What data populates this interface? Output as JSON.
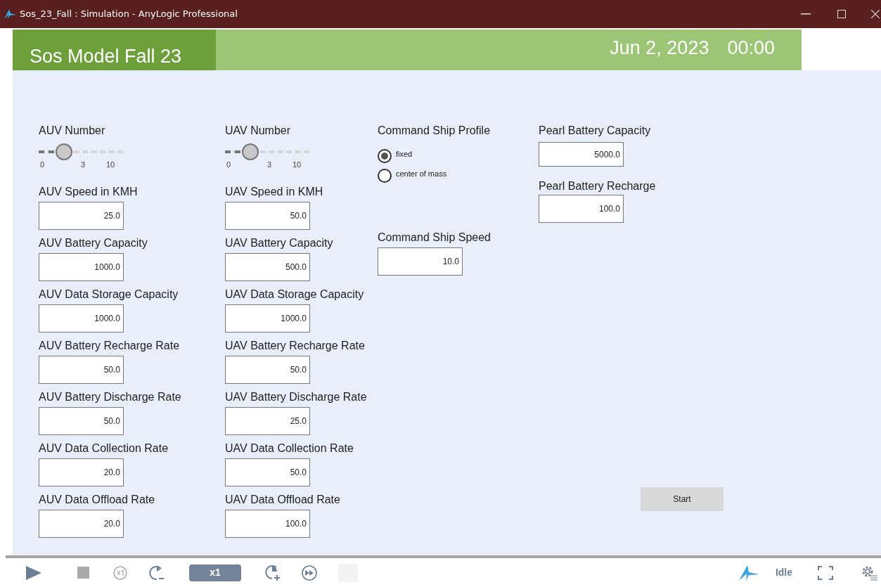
{
  "window": {
    "title": "Sos_23_Fall : Simulation - AnyLogic Professional"
  },
  "header": {
    "title": "Sos Model Fall 23",
    "date": "Jun 2, 2023",
    "time": "00:00"
  },
  "columns": [
    {
      "slider": {
        "label": "AUV Number",
        "level": 0.3,
        "ticks": [
          "0",
          "3",
          "10"
        ]
      },
      "fields": [
        {
          "label": "AUV Speed in KMH",
          "value": "25.0"
        },
        {
          "label": "AUV Battery Capacity",
          "value": "1000.0"
        },
        {
          "label": "AUV Data Storage Capacity",
          "value": "1000.0"
        },
        {
          "label": "AUV Battery Recharge Rate",
          "value": "50.0"
        },
        {
          "label": "AUV Battery Discharge Rate",
          "value": "50.0"
        },
        {
          "label": "AUV Data Collection Rate",
          "value": "20.0"
        },
        {
          "label": "AUV Data Offload Rate",
          "value": "20.0"
        }
      ]
    },
    {
      "slider": {
        "label": "UAV Number",
        "level": 0.3,
        "ticks": [
          "0",
          "3",
          "10"
        ]
      },
      "fields": [
        {
          "label": "UAV Speed in KMH",
          "value": "50.0"
        },
        {
          "label": "UAV Battery Capacity",
          "value": "500.0"
        },
        {
          "label": "UAV Data Storage Capacity",
          "value": "1000.0"
        },
        {
          "label": "UAV Battery Recharge Rate",
          "value": "50.0"
        },
        {
          "label": "UAV Battery Discharge Rate",
          "value": "25.0"
        },
        {
          "label": "UAV Data Collection Rate",
          "value": "50.0"
        },
        {
          "label": "UAV Data Offload Rate",
          "value": "100.0"
        }
      ]
    }
  ],
  "command_ship": {
    "profile_label": "Command Ship Profile",
    "options": [
      {
        "label": "fixed",
        "selected": true
      },
      {
        "label": "center of mass",
        "selected": false
      }
    ],
    "speed": {
      "label": "Command Ship Speed",
      "value": "10.0"
    }
  },
  "pearl": [
    {
      "label": "Pearl Battery Capacity",
      "value": "5000.0"
    },
    {
      "label": "Pearl Battery Recharge",
      "value": "100.0"
    }
  ],
  "start_button": "Start",
  "toolbar": {
    "speed": "x1",
    "status": "Idle"
  }
}
